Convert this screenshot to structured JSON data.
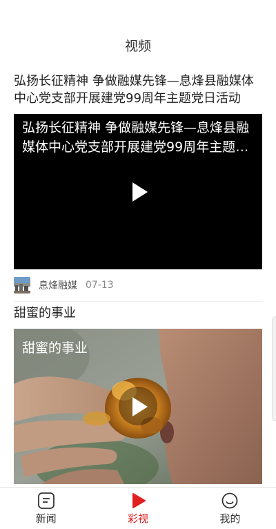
{
  "header": {
    "title": "视频"
  },
  "feed": {
    "items": [
      {
        "title": "弘扬长征精神 争做融媒先锋—息烽县融媒体中心党支部开展建党99周年主题党日活动",
        "overlay_title": "弘扬长征精神 争做融媒先锋—息烽县融媒体中心党支部开展建党99周年主题党日活动",
        "source": "息烽融媒",
        "date": "07-13"
      },
      {
        "title": "甜蜜的事业",
        "overlay_title": "甜蜜的事业"
      }
    ]
  },
  "tabbar": {
    "tabs": [
      {
        "label": "新闻",
        "icon": "news-icon",
        "active": false
      },
      {
        "label": "彩视",
        "icon": "video-play-icon",
        "active": true,
        "color": "#e02020"
      },
      {
        "label": "我的",
        "icon": "profile-smile-icon",
        "active": false
      }
    ]
  },
  "colors": {
    "accent": "#e02020",
    "video_bg": "#000000"
  }
}
